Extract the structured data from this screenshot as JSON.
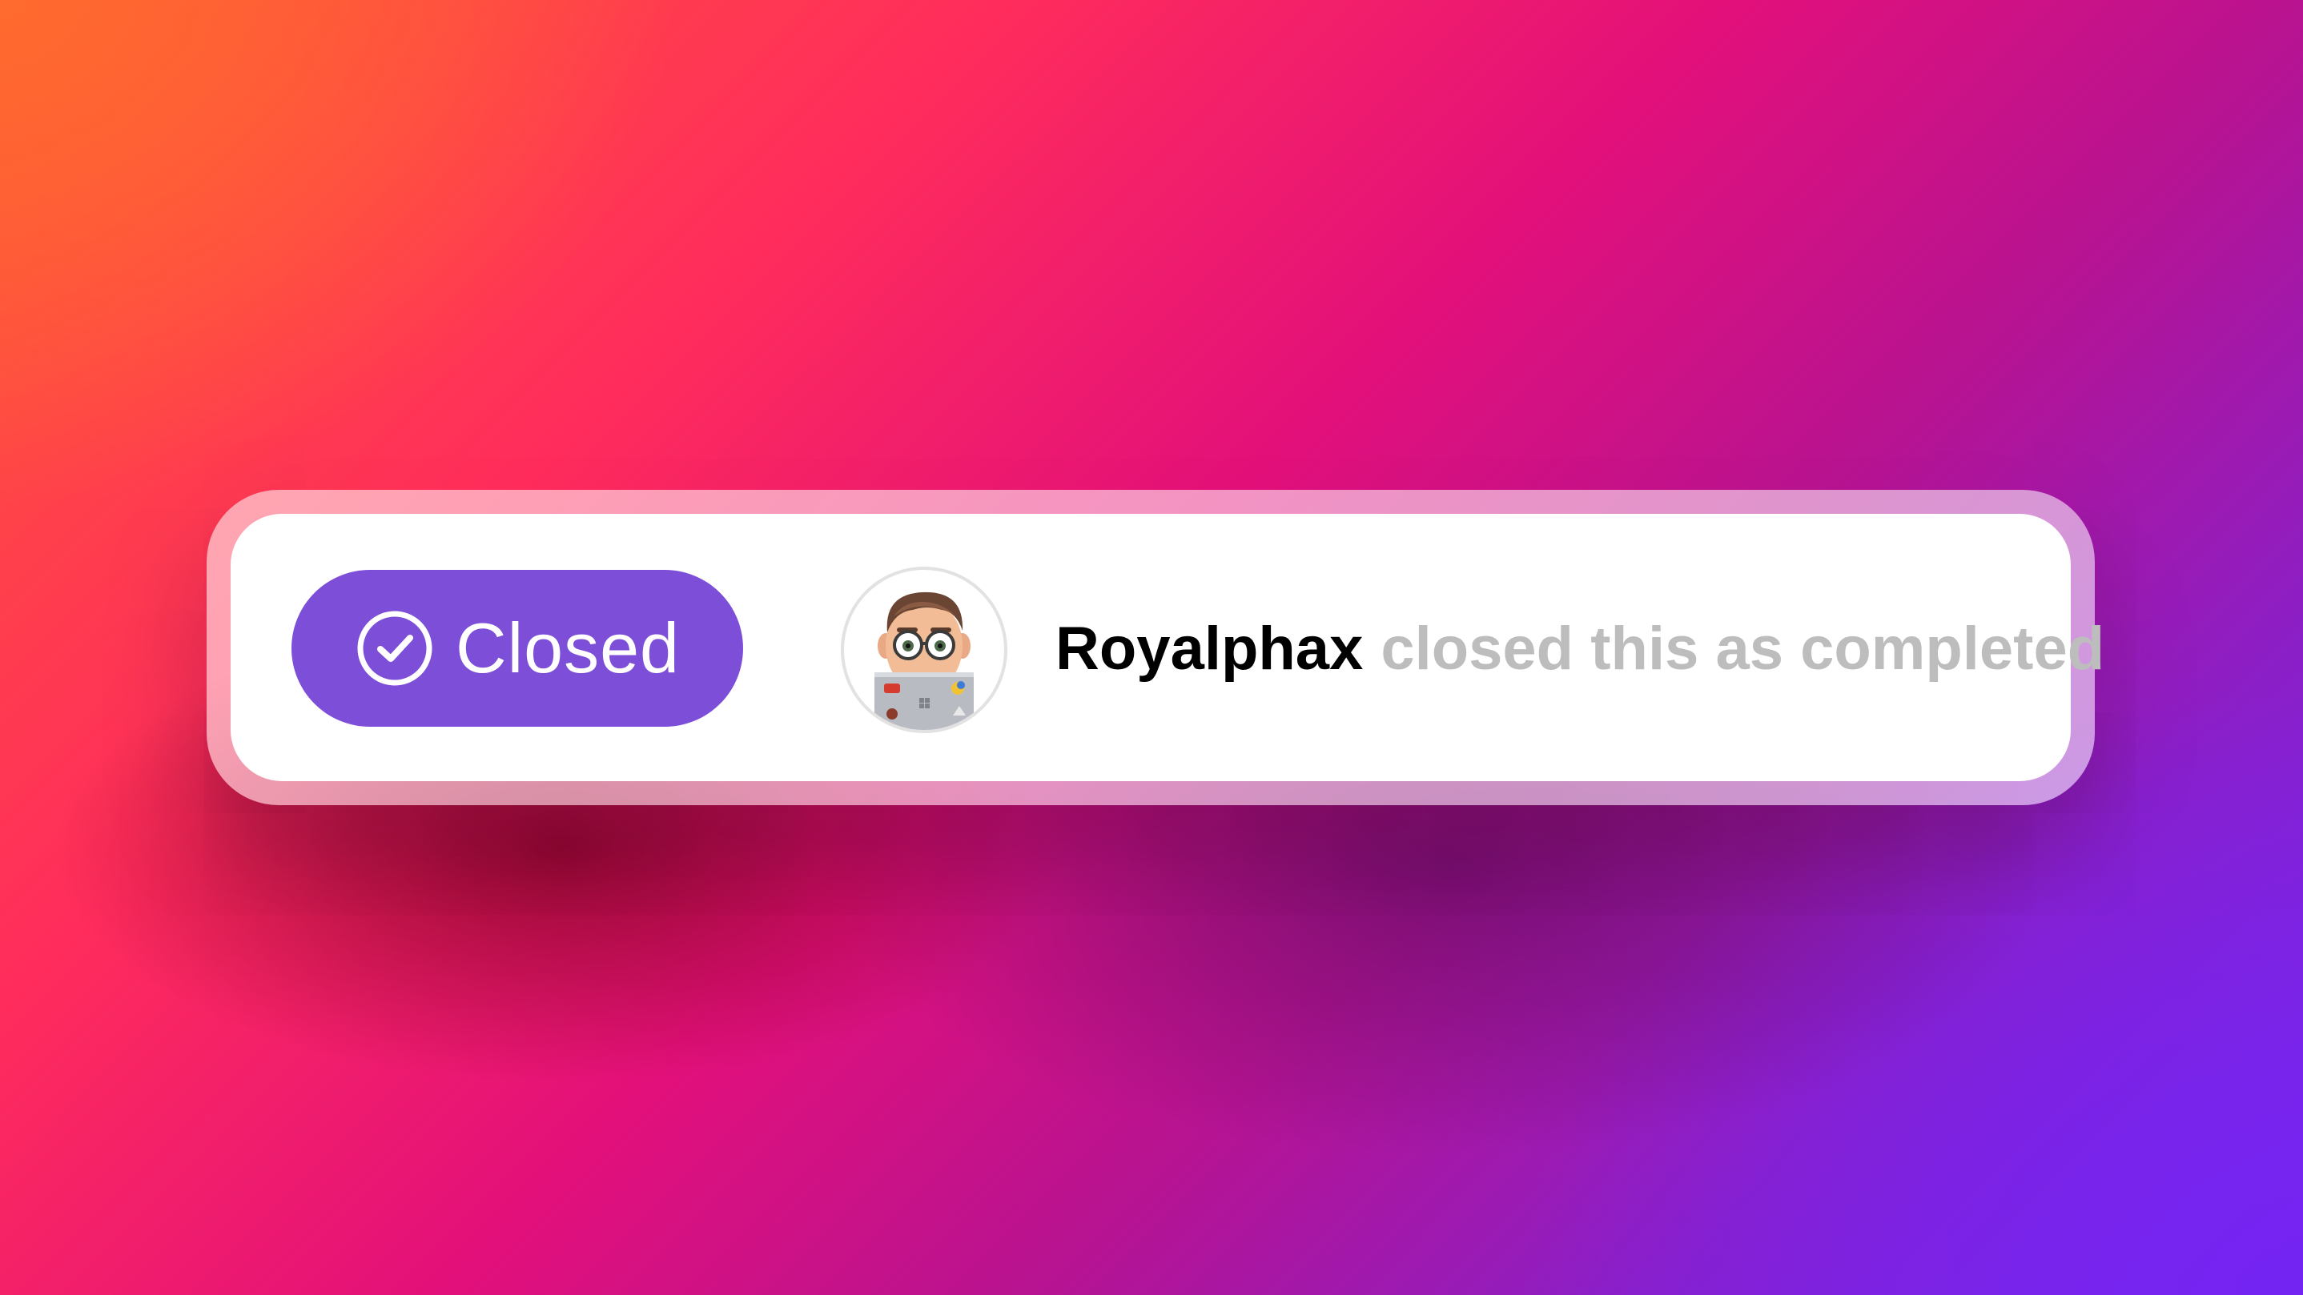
{
  "event": {
    "status_label": "Closed",
    "status_icon": "check-circle-icon",
    "username": "Royalphax",
    "action_text": "closed this as completed",
    "avatar": "memoji-avatar-with-laptop"
  },
  "colors": {
    "status_pill": "#7d4fd9",
    "username_text": "#000000",
    "action_text": "#bdbdbd",
    "card_background": "#ffffff"
  }
}
